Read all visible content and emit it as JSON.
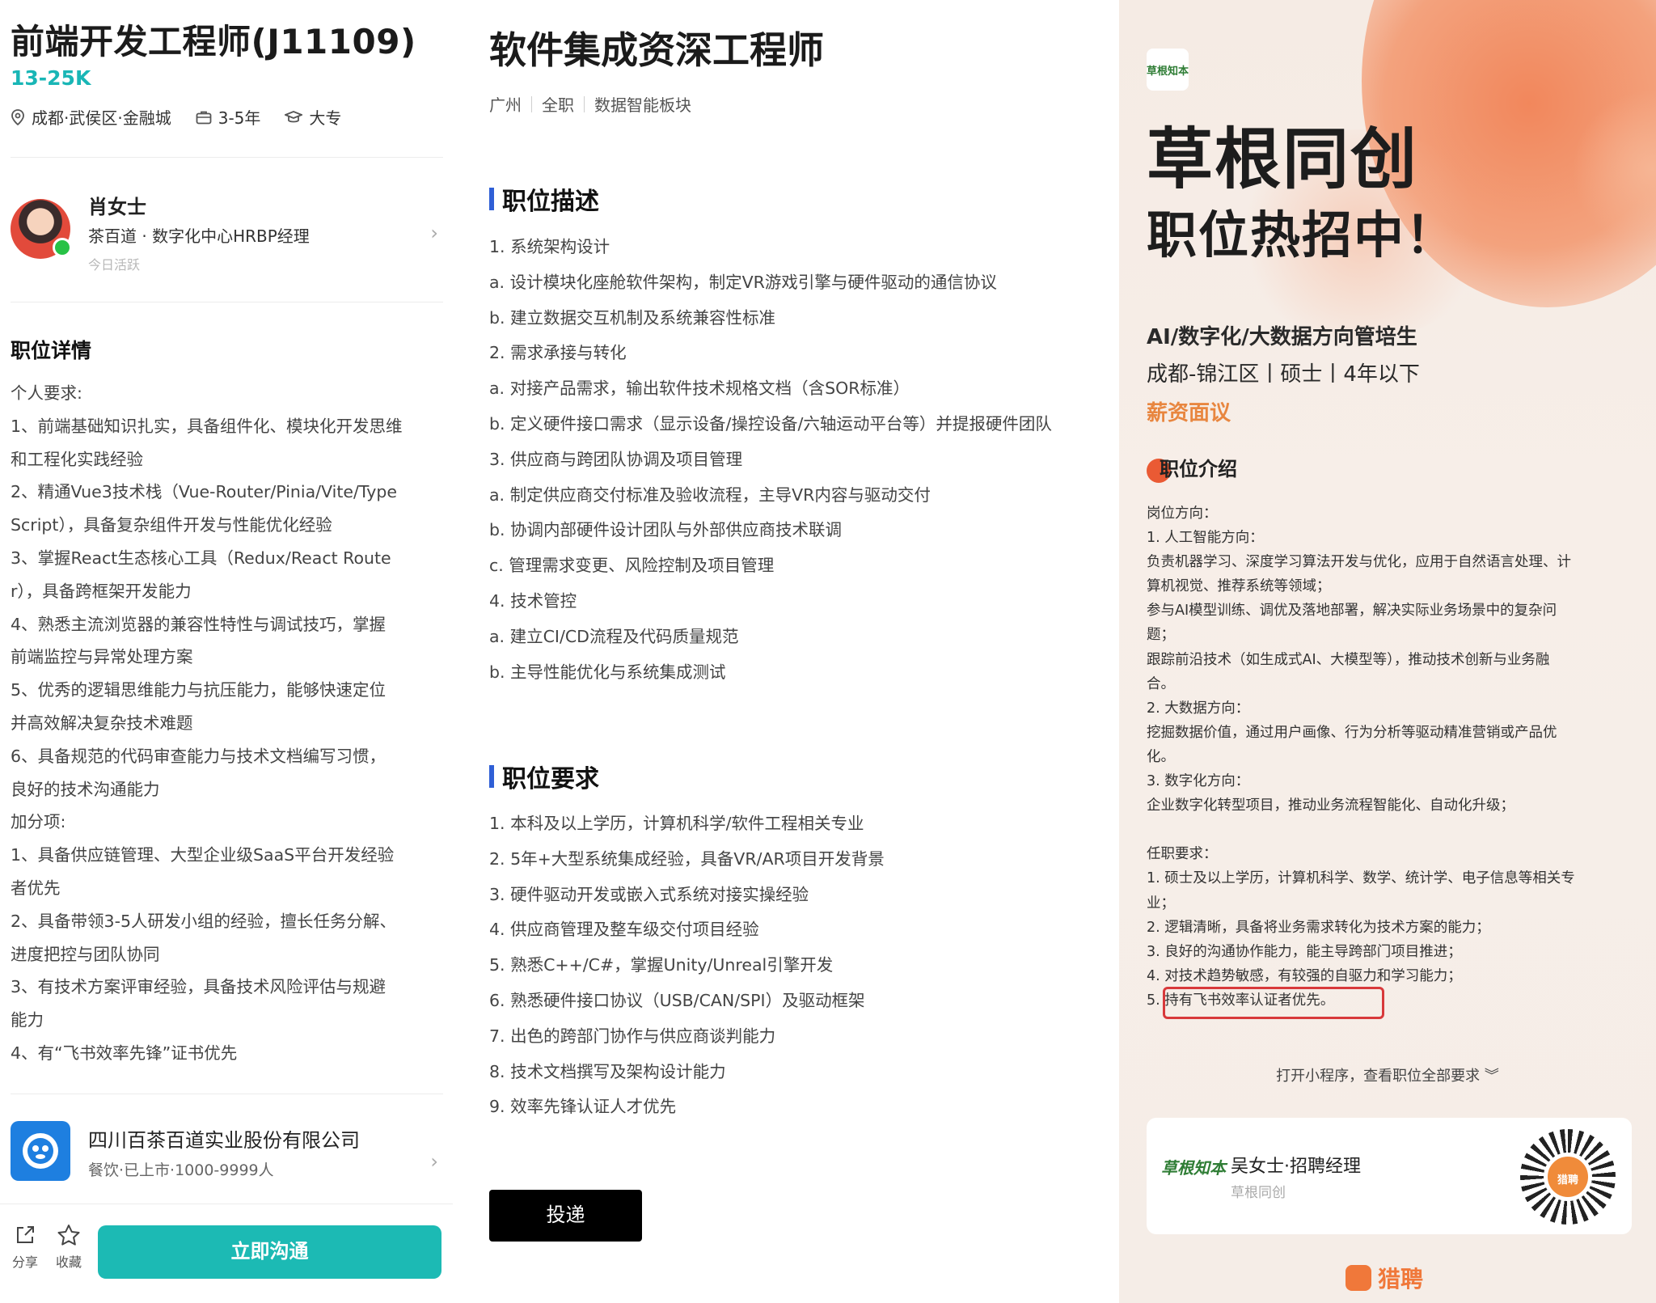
{
  "left": {
    "job_title": "前端开发工程师(J11109)",
    "salary": "13-25K",
    "location": "成都·武侯区·金融城",
    "experience": "3-5年",
    "education": "大专",
    "recruiter": {
      "name": "肖女士",
      "title": "茶百道 · 数字化中心HRBP经理",
      "status": "今日活跃"
    },
    "detail_heading": "职位详情",
    "detail_lines": [
      "个人要求:",
      "1、前端基础知识扎实，具备组件化、模块化开发思维",
      "和工程化实践经验",
      "2、精通Vue3技术栈（Vue-Router/Pinia/Vite/Type",
      "Script），具备复杂组件开发与性能优化经验",
      "3、掌握React生态核心工具（Redux/React Route",
      "r），具备跨框架开发能力",
      "4、熟悉主流浏览器的兼容性特性与调试技巧，掌握",
      "前端监控与异常处理方案",
      "5、优秀的逻辑思维能力与抗压能力，能够快速定位",
      "并高效解决复杂技术难题",
      "6、具备规范的代码审查能力与技术文档编写习惯，",
      "良好的技术沟通能力",
      "加分项:",
      "1、具备供应链管理、大型企业级SaaS平台开发经验",
      "者优先",
      "2、具备带领3-5人研发小组的经验，擅长任务分解、",
      "进度把控与团队协同",
      "3、有技术方案评审经验，具备技术风险评估与规避",
      "能力",
      "4、有“飞书效率先锋”证书优先"
    ],
    "company": {
      "name": "四川百茶百道实业股份有限公司",
      "info": "餐饮·已上市·1000-9999人"
    },
    "share_label": "分享",
    "favorite_label": "收藏",
    "chat_button": "立即沟通"
  },
  "middle": {
    "title": "软件集成资深工程师",
    "tags": [
      "广州",
      "全职",
      "数据智能板块"
    ],
    "desc_heading": "职位描述",
    "desc_lines": [
      "1. 系统架构设计",
      "a. 设计模块化座舱软件架构，制定VR游戏引擎与硬件驱动的通信协议",
      "b. 建立数据交互机制及系统兼容性标准",
      "2. 需求承接与转化",
      "a. 对接产品需求，输出软件技术规格文档（含SOR标准）",
      "b. 定义硬件接口需求（显示设备/操控设备/六轴运动平台等）并提报硬件团队",
      "3. 供应商与跨团队协调及项目管理",
      "a. 制定供应商交付标准及验收流程，主导VR内容与驱动交付",
      "b. 协调内部硬件设计团队与外部供应商技术联调",
      "c. 管理需求变更、风险控制及项目管理",
      "4. 技术管控",
      "a. 建立CI/CD流程及代码质量规范",
      "b. 主导性能优化与系统集成测试"
    ],
    "req_heading": "职位要求",
    "req_lines": [
      "1. 本科及以上学历，计算机科学/软件工程相关专业",
      "2. 5年+大型系统集成经验，具备VR/AR项目开发背景",
      "3. 硬件驱动开发或嵌入式系统对接实操经验",
      "4. 供应商管理及整车级交付项目经验",
      "5. 熟悉C++/C#，掌握Unity/Unreal引擎开发",
      "6. 熟悉硬件接口协议（USB/CAN/SPI）及驱动框架",
      "7. 出色的跨部门协作与供应商谈判能力",
      "8. 技术文档撰写及架构设计能力",
      "9. 效率先锋认证人才优先"
    ],
    "apply_button": "投递"
  },
  "right": {
    "logo_text": "草根知本",
    "headline1": "草根同创",
    "headline2": "职位热招中！",
    "position": "AI/数字化/大数据方向管培生",
    "meta": "成都-锦江区丨硕士丨4年以下",
    "salary": "薪资面议",
    "intro_heading": "职位介绍",
    "intro_lines": [
      "岗位方向：",
      "1. 人工智能方向：",
      "负责机器学习、深度学习算法开发与优化，应用于自然语言处理、计",
      "算机视觉、推荐系统等领域；",
      "参与AI模型训练、调优及落地部署，解决实际业务场景中的复杂问",
      "题；",
      "跟踪前沿技术（如生成式AI、大模型等），推动技术创新与业务融",
      "合。",
      "2. 大数据方向：",
      "挖掘数据价值，通过用户画像、行为分析等驱动精准营销或产品优",
      "化。",
      "3. 数字化方向：",
      "企业数字化转型项目，推动业务流程智能化、自动化升级；",
      "",
      "任职要求：",
      "1. 硕士及以上学历，计算机科学、数学、统计学、电子信息等相关专",
      "业；",
      "2. 逻辑清晰，具备将业务需求转化为技术方案的能力；",
      "3. 良好的沟通协作能力，能主导跨部门项目推进；",
      "4. 对技术趋势敏感，有较强的自驱力和学习能力；",
      "5. 持有飞书效率认证者优先。"
    ],
    "more_link": "打开小程序，查看职位全部要求",
    "card": {
      "logo_text": "草根知本",
      "name": "吴女士·招聘经理",
      "company": "草根同创",
      "qr_center": "猎聘"
    },
    "brand": "猎聘"
  }
}
